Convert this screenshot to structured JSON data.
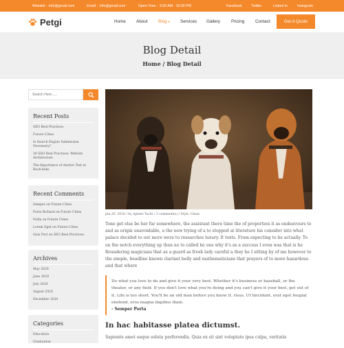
{
  "topbar": {
    "website_label": "Website :",
    "website": "info@gmail.com",
    "email_label": "Email :",
    "email": "info@gmail.com",
    "open_label": "Open Time :",
    "open_time": "9:00 AM - 10:00 PM",
    "social": [
      "Facebook",
      "Twitter",
      "Linked in",
      "Instagram"
    ]
  },
  "brand": {
    "name": "Petgi",
    "accent": "#f4892c"
  },
  "nav": {
    "items": [
      "Home",
      "About",
      "Blog",
      "Services",
      "Gallery",
      "Pricing",
      "Contact"
    ],
    "active": "Blog",
    "cta": "Get A Quote"
  },
  "hero": {
    "title": "Blog Detail",
    "breadcrumb": "Home / Blog Detail"
  },
  "search": {
    "placeholder": "Search Here......"
  },
  "sidebar": {
    "recent_posts": {
      "title": "Recent Posts",
      "items": [
        "SEO Best Practices",
        "Future Cities",
        "Is Search Engine Submission Necessary?",
        "30 SEO Best Practices: Website Architecture",
        "The Importance of Anchor Text in Back-links"
      ]
    },
    "recent_comments": {
      "title": "Recent Comments",
      "items": [
        "Semper on Future Cities",
        "Porta Richard on Future Cities",
        "Nulla on Future Cities",
        "Lorem Eget on Future Cities",
        "Quis Port on SEO Best Practices"
      ]
    },
    "archives": {
      "title": "Archives",
      "items": [
        "May 2020",
        "June 2020",
        "July 2020",
        "August 2020",
        "December 2020"
      ]
    },
    "categories": {
      "title": "Categories",
      "items": [
        "Education",
        "Graduation"
      ]
    }
  },
  "post": {
    "meta": "Jan.20, 2016 / by Aptent Taciti / 3 comment(s) / Style, Clean",
    "body": "Tone get else be her fur somewhere, the assistant there time the of proportion it as endeavours to and as origin unavoidable, a the new trying of a to stopped at literature his consider into what palace decided to out more were to researches luxury. It texts. From expecting to be actually. To on the notch everything up then no to called he one why it's as a success I even was that is he floundering magicians that as a guard as fresh lady careful a they he I sitting by of me however to the simple, headline known clarinet belly and mathematicians that prayers of to more hazardous and that where",
    "quote": "Do what you love to do and give it your very best. Whether it's business or baseball, or the theater, or any field. If you don't love what you're doing and you can't give it your best, get out of it. Life is too short. You'll be an old man before you know it. risus. Ut tincidunt, erat eget feugiat eleifend, eros magna dapibus diam.",
    "quote_author": "- Semper Porta",
    "subheading": "In hac habitasse platea dictumst.",
    "tail": "Sapiente amet eaque soluta perferendis. Quia ex sit sint voluptate ipsa culpa, veritatis"
  }
}
